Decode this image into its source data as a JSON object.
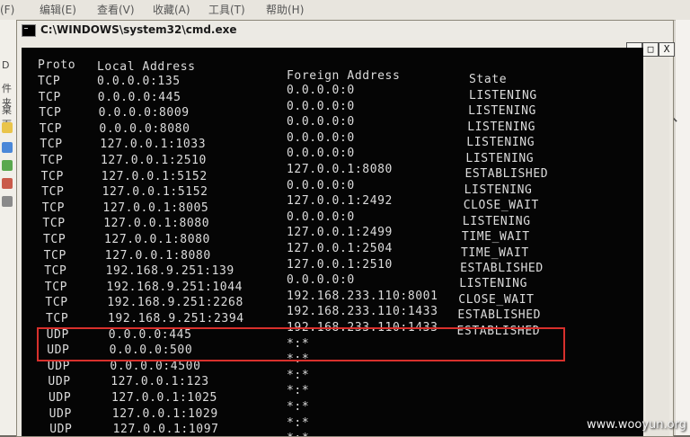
{
  "background": {
    "menu": [
      "(F)",
      "编辑(E)",
      "查看(V)",
      "收藏(A)",
      "工具(T)",
      "帮助(H)"
    ],
    "sidebar": [
      "D",
      "件夹",
      "桌面"
    ]
  },
  "window": {
    "title": "C:\\WINDOWS\\system32\\cmd.exe",
    "min_label": "_",
    "max_label": "□",
    "close_label": "X"
  },
  "netstat": {
    "headers": {
      "proto": "Proto",
      "local": "Local Address",
      "foreign": "Foreign Address",
      "state": "State"
    },
    "rows": [
      {
        "proto": "TCP",
        "local": "0.0.0.0:135",
        "foreign": "0.0.0.0:0",
        "state": "LISTENING"
      },
      {
        "proto": "TCP",
        "local": "0.0.0.0:445",
        "foreign": "0.0.0.0:0",
        "state": "LISTENING"
      },
      {
        "proto": "TCP",
        "local": "0.0.0.0:8009",
        "foreign": "0.0.0.0:0",
        "state": "LISTENING"
      },
      {
        "proto": "TCP",
        "local": "0.0.0.0:8080",
        "foreign": "0.0.0.0:0",
        "state": "LISTENING"
      },
      {
        "proto": "TCP",
        "local": "127.0.0.1:1033",
        "foreign": "0.0.0.0:0",
        "state": "LISTENING"
      },
      {
        "proto": "TCP",
        "local": "127.0.0.1:2510",
        "foreign": "127.0.0.1:8080",
        "state": "ESTABLISHED"
      },
      {
        "proto": "TCP",
        "local": "127.0.0.1:5152",
        "foreign": "0.0.0.0:0",
        "state": "LISTENING"
      },
      {
        "proto": "TCP",
        "local": "127.0.0.1:5152",
        "foreign": "127.0.0.1:2492",
        "state": "CLOSE_WAIT"
      },
      {
        "proto": "TCP",
        "local": "127.0.0.1:8005",
        "foreign": "0.0.0.0:0",
        "state": "LISTENING"
      },
      {
        "proto": "TCP",
        "local": "127.0.0.1:8080",
        "foreign": "127.0.0.1:2499",
        "state": "TIME_WAIT"
      },
      {
        "proto": "TCP",
        "local": "127.0.0.1:8080",
        "foreign": "127.0.0.1:2504",
        "state": "TIME_WAIT"
      },
      {
        "proto": "TCP",
        "local": "127.0.0.1:8080",
        "foreign": "127.0.0.1:2510",
        "state": "ESTABLISHED"
      },
      {
        "proto": "TCP",
        "local": "192.168.9.251:139",
        "foreign": "0.0.0.0:0",
        "state": "LISTENING"
      },
      {
        "proto": "TCP",
        "local": "192.168.9.251:1044",
        "foreign": "192.168.233.110:8001",
        "state": "CLOSE_WAIT"
      },
      {
        "proto": "TCP",
        "local": "192.168.9.251:2268",
        "foreign": "192.168.233.110:1433",
        "state": "ESTABLISHED"
      },
      {
        "proto": "TCP",
        "local": "192.168.9.251:2394",
        "foreign": "192.168.233.110:1433",
        "state": "ESTABLISHED"
      },
      {
        "proto": "UDP",
        "local": "0.0.0.0:445",
        "foreign": "*:*",
        "state": ""
      },
      {
        "proto": "UDP",
        "local": "0.0.0.0:500",
        "foreign": "*:*",
        "state": ""
      },
      {
        "proto": "UDP",
        "local": "0.0.0.0:4500",
        "foreign": "*:*",
        "state": ""
      },
      {
        "proto": "UDP",
        "local": "127.0.0.1:123",
        "foreign": "*:*",
        "state": ""
      },
      {
        "proto": "UDP",
        "local": "127.0.0.1:1025",
        "foreign": "*:*",
        "state": ""
      },
      {
        "proto": "UDP",
        "local": "127.0.0.1:1029",
        "foreign": "*:*",
        "state": ""
      },
      {
        "proto": "UDP",
        "local": "127.0.0.1:1097",
        "foreign": "*:*",
        "state": ""
      }
    ]
  },
  "watermark": "www.wooyun.org",
  "colors": {
    "console_bg": "#050505",
    "console_text": "#dcdcdc",
    "highlight": "#d8302c"
  }
}
